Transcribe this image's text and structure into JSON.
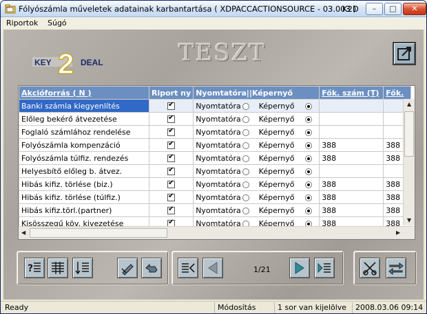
{
  "window": {
    "title": "Fólyószámla műveletek adatainak karbantartása ( XDPACCACTIONSOURCE - 03.003 )",
    "app_code": "K2D",
    "minimize_label": "–",
    "maximize_label": "□",
    "close_label": "✕"
  },
  "menu": {
    "items": [
      {
        "label": "Riportok"
      },
      {
        "label": "Súgó"
      }
    ]
  },
  "banner": {
    "logo_left": "KEY",
    "logo_number": "2",
    "logo_right": "DEAL",
    "environment_label": "TESZT"
  },
  "grid": {
    "columns": [
      {
        "label": "Akcióforrás ( N )"
      },
      {
        "label": "Riport ny"
      },
      {
        "label": "Nyomtatóra||Képernyő"
      },
      {
        "label": "Fők. szám (T)"
      },
      {
        "label": "Fők."
      }
    ],
    "rows": [
      {
        "name": "Banki számla kiegyenlítés",
        "riport": true,
        "nyomtatora": "Nyomtatóra",
        "kepernyo": "Képernyő",
        "fok_szam": "",
        "fok2": ""
      },
      {
        "name": "Előleg bekérő átvezetése",
        "riport": true,
        "nyomtatora": "Nyomtatóra",
        "kepernyo": "Képernyő",
        "fok_szam": "",
        "fok2": ""
      },
      {
        "name": "Foglaló számlához rendelése",
        "riport": true,
        "nyomtatora": "Nyomtatóra",
        "kepernyo": "Képernyő",
        "fok_szam": "",
        "fok2": ""
      },
      {
        "name": "Folyószámla kompenzáció",
        "riport": true,
        "nyomtatora": "Nyomtatóra",
        "kepernyo": "Képernyő",
        "fok_szam": "388",
        "fok2": "388"
      },
      {
        "name": "Folyószámla túlfiz. rendezés",
        "riport": true,
        "nyomtatora": "Nyomtatóra",
        "kepernyo": "Képernyő",
        "fok_szam": "388",
        "fok2": "388"
      },
      {
        "name": "Helyesbítő előleg b. átvez.",
        "riport": true,
        "nyomtatora": "Nyomtatóra",
        "kepernyo": "Képernyő",
        "fok_szam": "",
        "fok2": ""
      },
      {
        "name": "Hibás kifiz. törlése (biz.)",
        "riport": true,
        "nyomtatora": "Nyomtatóra",
        "kepernyo": "Képernyő",
        "fok_szam": "388",
        "fok2": "388"
      },
      {
        "name": "Hibás kifiz. törlése (túlfiz.)",
        "riport": true,
        "nyomtatora": "Nyomtatóra",
        "kepernyo": "Képernyő",
        "fok_szam": "388",
        "fok2": "388"
      },
      {
        "name": "Hibás kifiz.törl.(partner)",
        "riport": true,
        "nyomtatora": "Nyomtatóra",
        "kepernyo": "Képernyő",
        "fok_szam": "388",
        "fok2": "388"
      },
      {
        "name": "Kisösszegű köv. kivezetése",
        "riport": true,
        "nyomtatora": "Nyomtatóra",
        "kepernyo": "Képernyő",
        "fok_szam": "388",
        "fok2": "388"
      }
    ]
  },
  "pager": {
    "text": "1/21"
  },
  "toolbar_icons": [
    "help-list-icon",
    "list-icon",
    "sort-list-icon",
    "edit-pencil-icon",
    "undo-arrow-icon",
    "first-page-icon",
    "previous-page-icon",
    "next-page-icon",
    "last-page-icon",
    "cut-icon",
    "swap-arrows-icon"
  ],
  "status": {
    "state": "Ready",
    "mode": "Módosítás",
    "selection": "1 sor van kijelölve",
    "datetime": "2008.03.06 09:14"
  },
  "colors": {
    "header_bg": "#6b8fc1",
    "selected_row": "#3169c6",
    "panel_bg": "#b3aea7"
  }
}
